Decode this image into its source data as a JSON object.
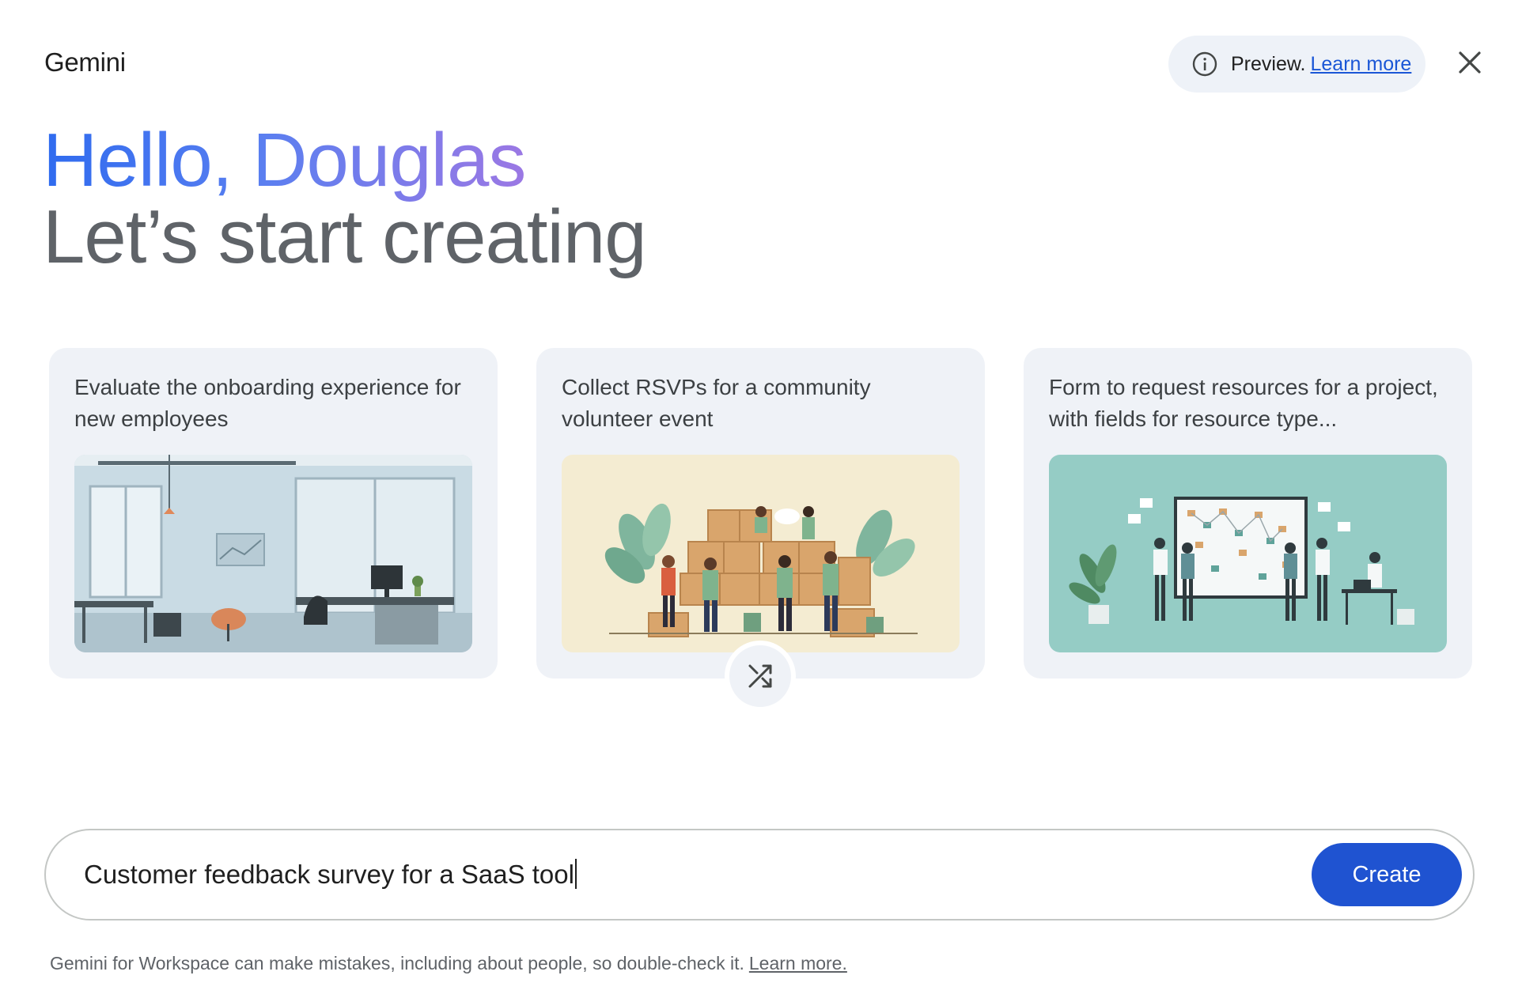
{
  "header": {
    "brand": "Gemini",
    "preview_label": "Preview.",
    "preview_link": "Learn more",
    "info_icon": "info-icon",
    "close_icon": "close-icon"
  },
  "greeting": {
    "hello": "Hello, Douglas",
    "subtitle": "Let’s start creating"
  },
  "cards": [
    {
      "title": "Evaluate the onboarding experience for new employees",
      "illustration": "office-interior"
    },
    {
      "title": "Collect RSVPs for a community volunteer event",
      "illustration": "volunteers-with-boxes"
    },
    {
      "title": "Form to request resources for a project, with fields for resource type...",
      "illustration": "team-at-whiteboard"
    }
  ],
  "shuffle_icon": "shuffle-icon",
  "prompt": {
    "value": "Customer feedback survey for a SaaS tool",
    "button": "Create"
  },
  "footer": {
    "disclaimer": "Gemini for Workspace can make mistakes, including about people, so double-check it.",
    "link": "Learn more."
  },
  "colors": {
    "accent": "#1f53d1",
    "card_bg": "#eff2f7",
    "greeting_gradient": [
      "#2f6bef",
      "#9b78e4"
    ],
    "subtitle": "#5f6368"
  }
}
